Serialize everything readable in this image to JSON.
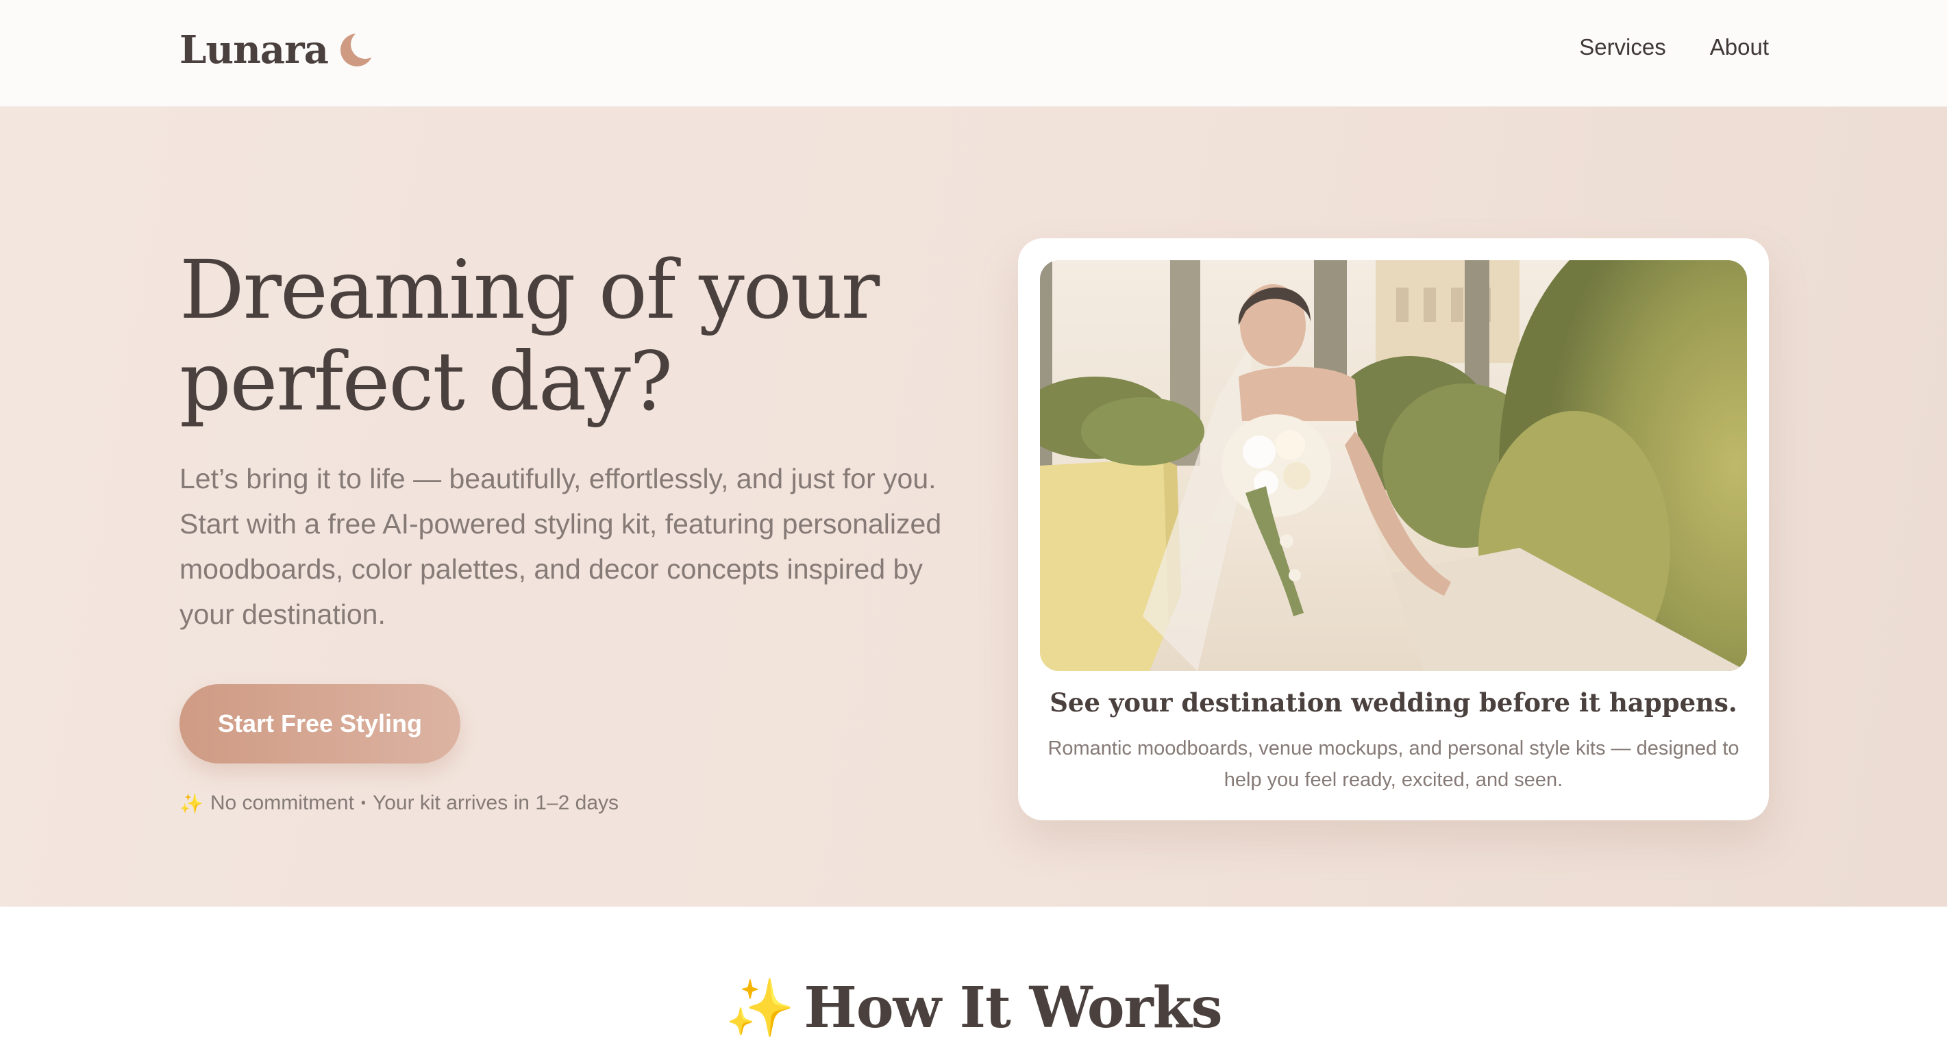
{
  "brand": {
    "name": "Lunara",
    "icon": "crescent-moon-icon",
    "icon_color": "#cf9a82"
  },
  "nav": {
    "items": [
      {
        "label": "Services"
      },
      {
        "label": "About"
      }
    ]
  },
  "hero": {
    "title_line1": "Dreaming of your",
    "title_line2": "perfect day?",
    "description": "Let’s bring it to life — beautifully, effortlessly, and just for you. Start with a free AI-powered styling kit, featuring personalized moodboards, color palettes, and decor concepts inspired by your destination.",
    "cta_label": "Start Free Styling",
    "note_icon": "sparkles-icon",
    "note_part1": "No commitment",
    "note_separator": "•",
    "note_part2": "Your kit arrives in 1–2 days"
  },
  "card": {
    "image_alt": "Bride holding a bouquet in a sunny garden",
    "title": "See your destination wedding before it happens.",
    "description": "Romantic moodboards, venue mockups, and personal style kits — designed to help you feel ready, excited, and seen."
  },
  "how_it_works": {
    "icon": "sparkles-icon",
    "title": "How It Works"
  },
  "colors": {
    "accent": "#cf9b84",
    "hero_bg": "#f2e4dc",
    "text_dark": "#4a403d",
    "text_muted": "#857a76"
  }
}
